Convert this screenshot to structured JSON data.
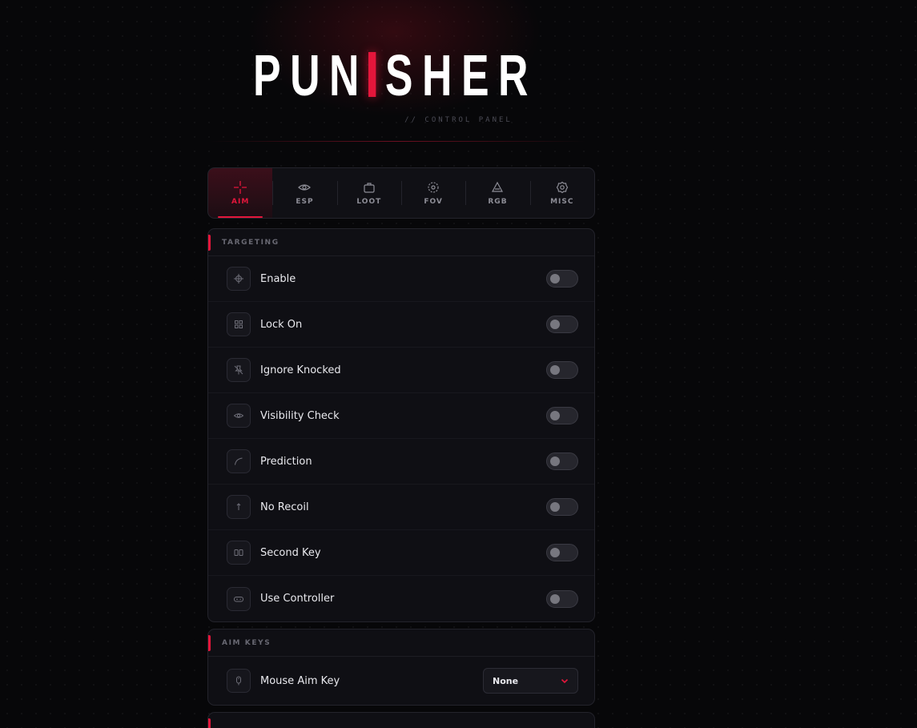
{
  "logo": {
    "before": "PUN",
    "after": "SHER"
  },
  "subtitle": "// CONTROL PANEL",
  "colors": {
    "accent": "#e4163b",
    "background": "#070709",
    "panel": "#0f0f14"
  },
  "tabs": [
    {
      "label": "AIM",
      "icon": "crosshair-icon",
      "active": true
    },
    {
      "label": "ESP",
      "icon": "eye-icon",
      "active": false
    },
    {
      "label": "LOOT",
      "icon": "briefcase-icon",
      "active": false
    },
    {
      "label": "FOV",
      "icon": "fov-circle-icon",
      "active": false
    },
    {
      "label": "RGB",
      "icon": "prism-icon",
      "active": false
    },
    {
      "label": "MISC",
      "icon": "gear-icon",
      "active": false
    }
  ],
  "targeting": {
    "title": "TARGETING",
    "items": [
      {
        "label": "Enable",
        "icon": "move-crosshair-icon",
        "enabled": false
      },
      {
        "label": "Lock On",
        "icon": "grid-icon",
        "enabled": false
      },
      {
        "label": "Ignore Knocked",
        "icon": "pin-off-icon",
        "enabled": false
      },
      {
        "label": "Visibility Check",
        "icon": "eye-icon",
        "enabled": false
      },
      {
        "label": "Prediction",
        "icon": "curve-icon",
        "enabled": false
      },
      {
        "label": "No Recoil",
        "icon": "arrow-up-icon",
        "enabled": false
      },
      {
        "label": "Second Key",
        "icon": "keys-icon",
        "enabled": false
      },
      {
        "label": "Use Controller",
        "icon": "gamepad-icon",
        "enabled": false
      }
    ]
  },
  "aim_keys": {
    "title": "AIM KEYS",
    "items": [
      {
        "label": "Mouse Aim Key",
        "icon": "mouse-icon",
        "value": "None"
      }
    ]
  }
}
